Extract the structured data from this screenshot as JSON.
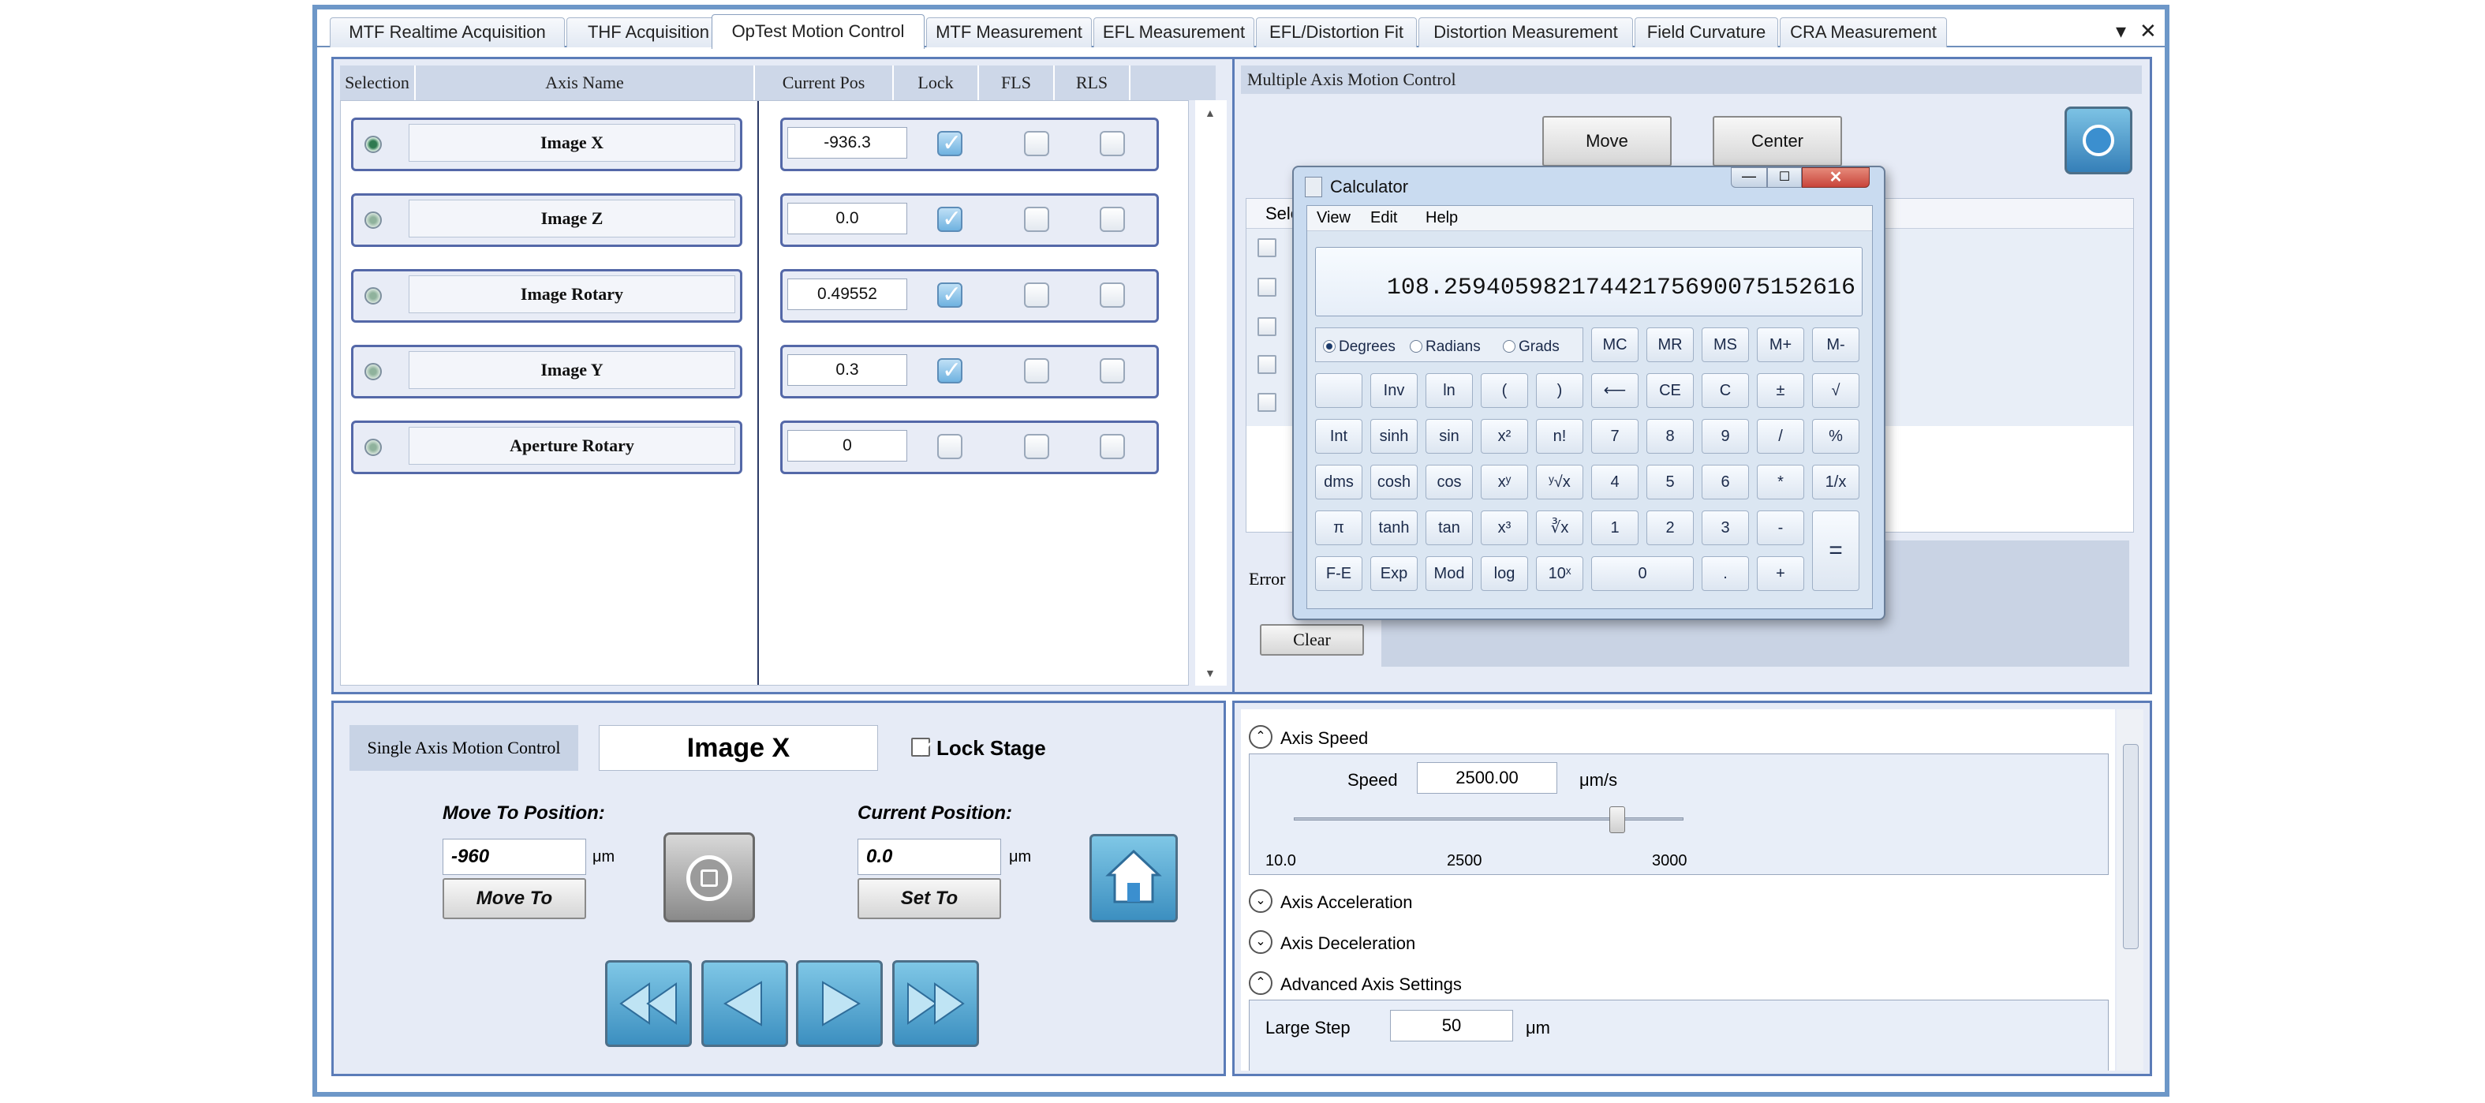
{
  "tabs": [
    "MTF Realtime Acquisition",
    "THF Acquisition",
    "OpTest Motion Control",
    "MTF Measurement",
    "EFL Measurement",
    "EFL/Distortion Fit",
    "Distortion Measurement",
    "Field Curvature",
    "CRA Measurement"
  ],
  "active_tab": "OpTest Motion Control",
  "tab_controls": {
    "dropdown": "▾",
    "close": "✕"
  },
  "axis_table": {
    "headers": {
      "selection": "Selection",
      "axis_name": "Axis Name",
      "current_pos": "Current Pos",
      "lock": "Lock",
      "fls": "FLS",
      "rls": "RLS"
    },
    "rows": [
      {
        "name": "Image X",
        "pos": "-936.3",
        "lock": true,
        "selected": true
      },
      {
        "name": "Image Z",
        "pos": "0.0",
        "lock": true,
        "selected": false
      },
      {
        "name": "Image Rotary",
        "pos": "0.49552",
        "lock": true,
        "selected": false
      },
      {
        "name": "Image Y",
        "pos": "0.3",
        "lock": true,
        "selected": false
      },
      {
        "name": "Aperture Rotary",
        "pos": "0",
        "lock": false,
        "selected": false
      }
    ]
  },
  "multi_axis": {
    "title": "Multiple Axis Motion Control",
    "move_label": "Move",
    "center_label": "Center",
    "col_header_partial": "Sele",
    "error_label_partial": "Error",
    "clear_label": "Clear"
  },
  "calculator": {
    "title": "Calculator",
    "menu": [
      "View",
      "Edit",
      "Help"
    ],
    "display": "108.25940598217442175690075152616",
    "angle_modes": [
      "Degrees",
      "Radians",
      "Grads"
    ],
    "selected_mode": "Degrees",
    "memory_buttons": [
      "MC",
      "MR",
      "MS",
      "M+",
      "M-"
    ],
    "rows": [
      [
        "",
        "Inv",
        "ln",
        "(",
        ")",
        "⟵",
        "CE",
        "C",
        "±",
        "√"
      ],
      [
        "Int",
        "sinh",
        "sin",
        "x²",
        "n!",
        "7",
        "8",
        "9",
        "/",
        "%"
      ],
      [
        "dms",
        "cosh",
        "cos",
        "xʸ",
        "ʸ√x",
        "4",
        "5",
        "6",
        "*",
        "1/x"
      ],
      [
        "π",
        "tanh",
        "tan",
        "x³",
        "∛x",
        "1",
        "2",
        "3",
        "-"
      ],
      [
        "F-E",
        "Exp",
        "Mod",
        "log",
        "10ˣ",
        "0",
        ".",
        "+"
      ]
    ],
    "equals": "="
  },
  "single_axis": {
    "title": "Single Axis Motion Control",
    "axis_name": "Image X",
    "lock_label": "Lock Stage",
    "lock_checked": true,
    "move_to_label": "Move To Position:",
    "move_to_value": "-960",
    "unit": "μm",
    "move_to_btn": "Move To",
    "current_label": "Current Position:",
    "current_value": "0.0",
    "set_to_btn": "Set To"
  },
  "settings": {
    "axis_speed_label": "Axis Speed",
    "speed_label": "Speed",
    "speed_value": "2500.00",
    "speed_unit": "μm/s",
    "slider_min": "10.0",
    "slider_mid": "2500",
    "slider_max": "3000",
    "slider_fraction": 0.83,
    "acceleration_label": "Axis Acceleration",
    "deceleration_label": "Axis Deceleration",
    "advanced_label": "Advanced Axis Settings",
    "large_step_label": "Large Step",
    "large_step_value": "50",
    "large_step_unit": "μm"
  },
  "colors": {
    "frame": "#6d97c8",
    "panel_border": "#5b7cb8",
    "panel_bg": "#e6ebf6",
    "header_bg": "#cdd7e8",
    "calc_title": "#c9dbf0",
    "close_red": "#c8443a"
  }
}
